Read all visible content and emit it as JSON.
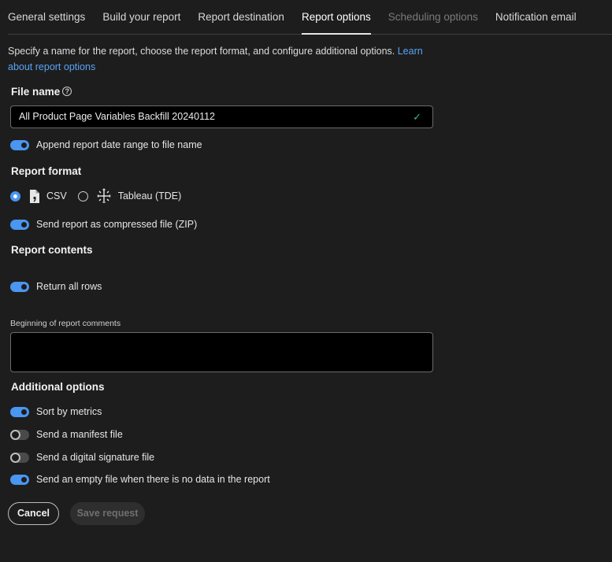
{
  "tabs": [
    {
      "label": "General settings",
      "state": "normal"
    },
    {
      "label": "Build your report",
      "state": "normal"
    },
    {
      "label": "Report destination",
      "state": "normal"
    },
    {
      "label": "Report options",
      "state": "active"
    },
    {
      "label": "Scheduling options",
      "state": "disabled"
    },
    {
      "label": "Notification email",
      "state": "normal"
    }
  ],
  "intro": {
    "text": "Specify a name for the report, choose the report format, and configure additional options. ",
    "link_text": "Learn about report options"
  },
  "file_name": {
    "heading": "File name",
    "value": "All Product Page Variables Backfill 20240112",
    "valid": true,
    "append_toggle_label": "Append report date range to file name",
    "append_toggle_on": true
  },
  "report_format": {
    "heading": "Report format",
    "options": [
      {
        "label": "CSV",
        "selected": true,
        "icon": "csv-file-icon"
      },
      {
        "label": "Tableau (TDE)",
        "selected": false,
        "icon": "tableau-icon"
      }
    ],
    "compress_label": "Send report as compressed file (ZIP)",
    "compress_on": true
  },
  "report_contents": {
    "heading": "Report contents",
    "return_all_rows_label": "Return all rows",
    "return_all_rows_on": true,
    "comments_label": "Beginning of report comments",
    "comments_value": ""
  },
  "additional_options": {
    "heading": "Additional options",
    "items": [
      {
        "label": "Sort by metrics",
        "on": true
      },
      {
        "label": "Send a manifest file",
        "on": false
      },
      {
        "label": "Send a digital signature file",
        "on": false
      },
      {
        "label": "Send an empty file when there is no data in the report",
        "on": true
      }
    ]
  },
  "actions": {
    "cancel_label": "Cancel",
    "save_label": "Save request",
    "save_enabled": false
  },
  "colors": {
    "background": "#1d1d1d",
    "accent": "#4a96f0",
    "link": "#58a3f5",
    "valid_check": "#2fc27a"
  }
}
